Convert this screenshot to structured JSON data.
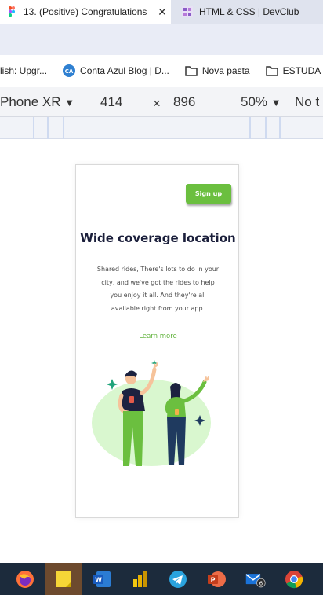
{
  "browser": {
    "tabs": [
      {
        "title": "13. (Positive) Congratulations",
        "close": "✕",
        "icon": "figma-icon",
        "active": true
      },
      {
        "title": "HTML & CSS | DevClub",
        "icon": "devclub-icon",
        "active": false
      }
    ],
    "bookmarks": [
      {
        "label": "lish: Upgr...",
        "icon": "none"
      },
      {
        "label": "Conta Azul Blog | D...",
        "icon": "ca-logo-icon",
        "icon_text": "CA"
      },
      {
        "label": "Nova pasta",
        "icon": "folder-icon"
      },
      {
        "label": "ESTUDA",
        "icon": "folder-icon"
      }
    ]
  },
  "devtools": {
    "device": "Phone XR",
    "width": "414",
    "times": "×",
    "height": "896",
    "zoom": "50%",
    "throttle": "No t"
  },
  "page": {
    "signup_label": "Sign up",
    "heading": "Wide coverage location",
    "description": "Shared rides, There's lots to do in your city, and we've got the rides to help you enjoy it all. And they're all available right from your app.",
    "learn_more": "Learn more"
  },
  "taskbar": {
    "items": [
      "firefox-icon",
      "sticky-notes-icon",
      "word-icon",
      "power-bi-icon",
      "telegram-icon",
      "powerpoint-icon",
      "mail-icon",
      "chrome-icon"
    ],
    "mail_badge": "6"
  },
  "colors": {
    "accent_green": "#6bbf3f",
    "heading_navy": "#1b1f3b",
    "taskbar": "#1c2b3c"
  }
}
